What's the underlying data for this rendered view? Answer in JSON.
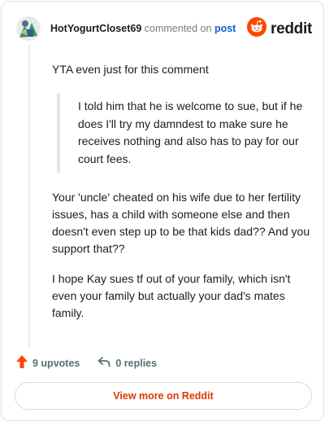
{
  "header": {
    "username": "HotYogurtCloset69",
    "verb": "commented on",
    "post_link": "post",
    "brand": "reddit"
  },
  "comment": {
    "p1": "YTA even just for this comment",
    "quote": "I told him that he is welcome to sue, but if he does I'll try my damndest to make sure he receives nothing and also has to pay for our court fees.",
    "p2": "Your 'uncle' cheated on his wife due to her fertility issues, has a child with someone else and then doesn't even step up to be that kids dad?? And you support that??",
    "p3": "I hope Kay sues tf out of your family, which isn't even your family but actually your dad's mates family."
  },
  "actions": {
    "upvotes": "9 upvotes",
    "replies": "0 replies"
  },
  "footer": {
    "view_more": "View more on Reddit"
  },
  "colors": {
    "brand_orange": "#ff4500",
    "link_blue": "#0a63c9",
    "cta_text": "#d93a00"
  }
}
